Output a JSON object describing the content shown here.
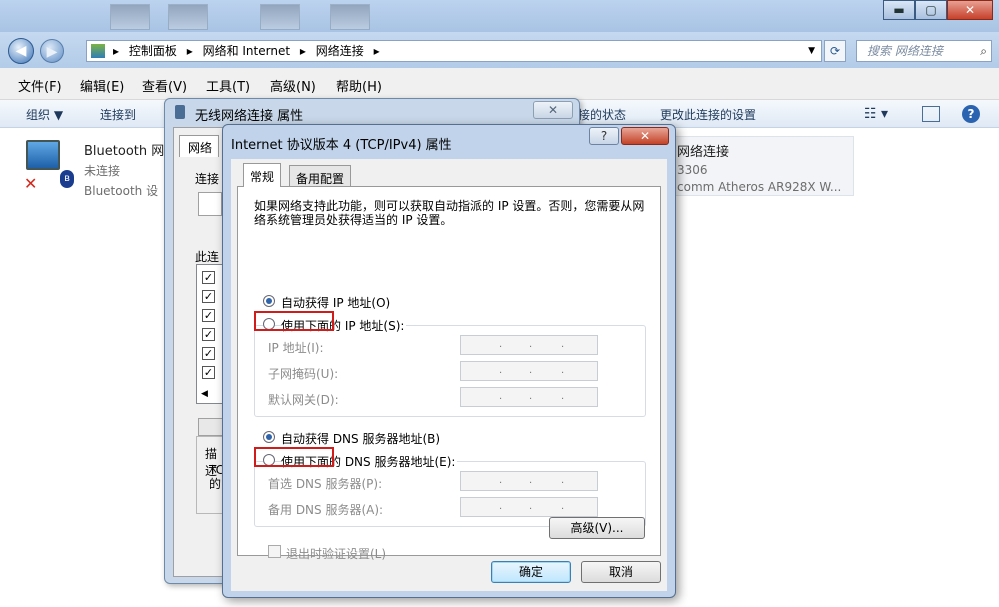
{
  "explorer": {
    "window_buttons": {
      "minimize": "▬",
      "maximize": "▢",
      "close": "✕"
    },
    "nav": {
      "back": "◀",
      "forward": "▶"
    },
    "breadcrumb": [
      "控制面板",
      "网络和 Internet",
      "网络连接"
    ],
    "search_placeholder": "搜索 网络连接",
    "menu": [
      "文件(F)",
      "编辑(E)",
      "查看(V)",
      "工具(T)",
      "高级(N)",
      "帮助(H)"
    ],
    "toolbar": {
      "organize": "组织 ▼",
      "connect_to": "连接到",
      "diagnose": "接的状态",
      "change_settings": "更改此连接的设置"
    },
    "connections": [
      {
        "line1": "Bluetooth 网",
        "line2": "未连接",
        "line3": "Bluetooth 设"
      },
      {
        "line1": "网络连接",
        "line2": "3306",
        "line3": "comm Atheros AR928X W..."
      }
    ]
  },
  "wireless_dialog": {
    "title": "无线网络连接 属性",
    "close": "✕",
    "tab": "网络",
    "label_connect": "连接",
    "label_this": "此连",
    "label_desc": "描述",
    "desc_text": [
      "TC",
      "的"
    ]
  },
  "ipv4_dialog": {
    "title": "Internet 协议版本 4 (TCP/IPv4) 属性",
    "help": "?",
    "close": "✕",
    "tabs": [
      "常规",
      "备用配置"
    ],
    "description": "如果网络支持此功能，则可以获取自动指派的 IP 设置。否则，您需要从网络系统管理员处获得适当的 IP 设置。",
    "ip": {
      "auto_label": "自动获得 IP 地址(O)",
      "manual_label": "使用下面的 IP 地址(S):",
      "fields": [
        "IP 地址(I):",
        "子网掩码(U):",
        "默认网关(D):"
      ]
    },
    "dns": {
      "auto_label": "自动获得 DNS 服务器地址(B)",
      "manual_label": "使用下面的 DNS 服务器地址(E):",
      "fields": [
        "首选 DNS 服务器(P):",
        "备用 DNS 服务器(A):"
      ]
    },
    "validate_label": "退出时验证设置(L)",
    "advanced": "高级(V)...",
    "ok": "确定",
    "cancel": "取消"
  }
}
